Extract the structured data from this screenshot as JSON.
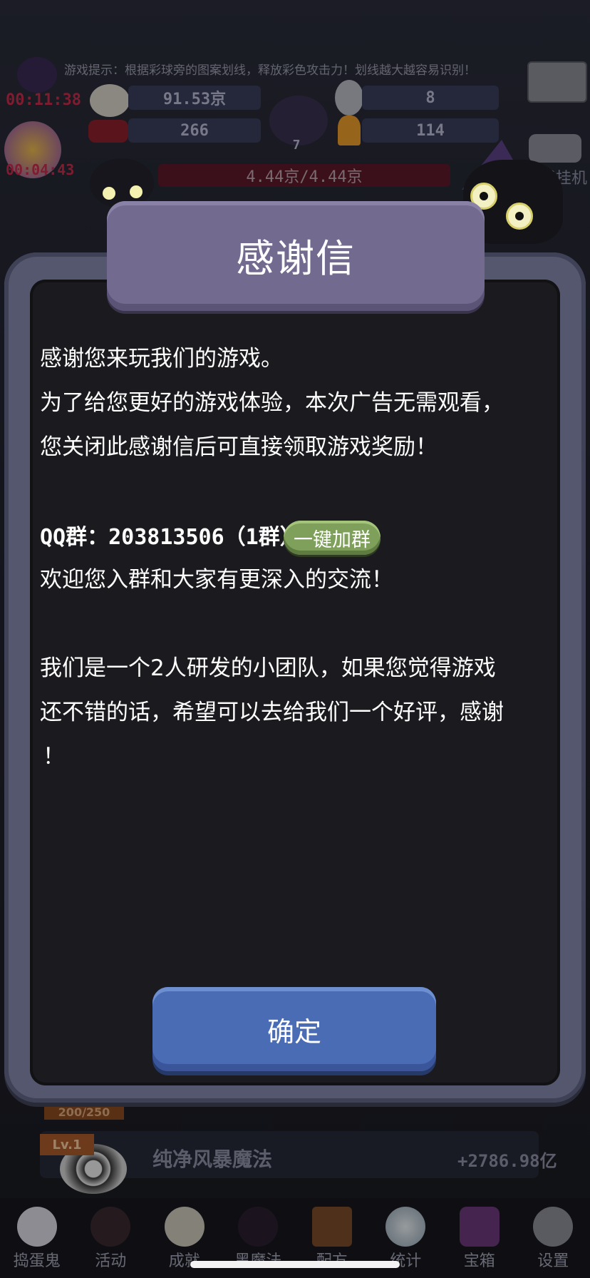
{
  "hud": {
    "tip": "游戏提示：根据彩球旁的图案划线，释放彩色攻击力！划线越大越容易识别！",
    "timer_1": "00:11:38",
    "timer_2": "00:04:43",
    "stat_gold": "91.53京",
    "stat_skull": "8",
    "stat_candy": "266",
    "stat_pot": "7",
    "stat_corn": "114",
    "hp": "4.44京/4.44京",
    "offline_label": "离线挂机"
  },
  "dialog": {
    "title": "感谢信",
    "line1": "感谢您来玩我们的游戏。",
    "line2": "为了给您更好的游戏体验，本次广告无需观看，",
    "line3": "您关闭此感谢信后可直接领取游戏奖励！",
    "qq_group": "QQ群：203813506（1群）",
    "join_button": "一键加群",
    "line4": "欢迎您入群和大家有更深入的交流！",
    "line5": "我们是一个2人研发的小团队，如果您觉得游戏",
    "line6": "还不错的话，希望可以去给我们一个好评，感谢",
    "line7": "！",
    "confirm_button": "确定"
  },
  "skill": {
    "progress": "200/250",
    "level": "Lv.1",
    "name": "纯净风暴魔法",
    "value": "+2786.98亿"
  },
  "nav": {
    "items": [
      {
        "label": "捣蛋鬼",
        "icon": "ghost-icon"
      },
      {
        "label": "活动",
        "icon": "monster-icon"
      },
      {
        "label": "成就",
        "icon": "skull-icon"
      },
      {
        "label": "黑魔法",
        "icon": "demon-icon"
      },
      {
        "label": "配方",
        "icon": "book-icon"
      },
      {
        "label": "统计",
        "icon": "crystal-ball-icon"
      },
      {
        "label": "宝箱",
        "icon": "chest-icon"
      },
      {
        "label": "设置",
        "icon": "gear-icon"
      }
    ]
  },
  "colors": {
    "confirm": "#4a6cb4",
    "join": "#7fa05a",
    "plank": "#736a90",
    "timer": "#c42b4a"
  }
}
